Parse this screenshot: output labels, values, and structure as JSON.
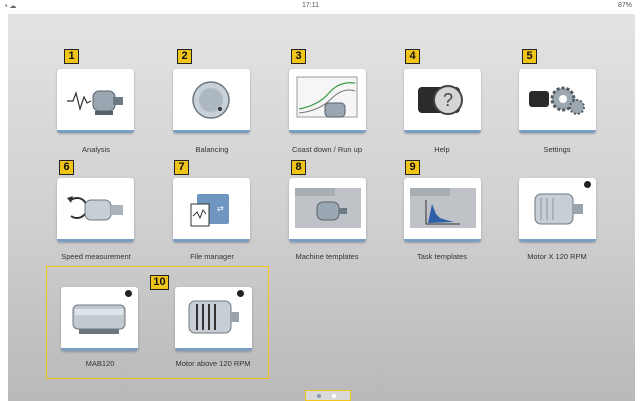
{
  "status_bar": {
    "left_icons": "wifi-icon cloud-icon",
    "time": "17:11",
    "battery": "87%"
  },
  "tiles": [
    {
      "label": "Analysis",
      "number": "1",
      "icon": "vibration-motor-icon"
    },
    {
      "label": "Balancing",
      "number": "2",
      "icon": "balancing-disc-icon"
    },
    {
      "label": "Coast down / Run up",
      "number": "3",
      "icon": "coast-down-chart-icon"
    },
    {
      "label": "Help",
      "number": "4",
      "icon": "help-camera-icon"
    },
    {
      "label": "Settings",
      "number": "5",
      "icon": "settings-gears-icon"
    },
    {
      "label": "Speed measurement",
      "number": "6",
      "icon": "speed-measurement-icon"
    },
    {
      "label": "File manager",
      "number": "7",
      "icon": "file-manager-icon"
    },
    {
      "label": "Machine templates",
      "number": "8",
      "icon": "machine-templates-icon"
    },
    {
      "label": "Task templates",
      "number": "9",
      "icon": "task-templates-icon"
    },
    {
      "label": "Motor X 120 RPM",
      "number": "",
      "icon": "motor-icon"
    },
    {
      "label": "MAB120",
      "number": "",
      "icon": "motor-housing-icon"
    },
    {
      "label": "Motor above 120 RPM",
      "number": "",
      "icon": "motor-finned-icon"
    }
  ],
  "group_number": "10",
  "pager": {
    "pages": 2,
    "current": 1
  },
  "colors": {
    "accent": "#f0c419",
    "tile_border": "#7a9ec3"
  }
}
